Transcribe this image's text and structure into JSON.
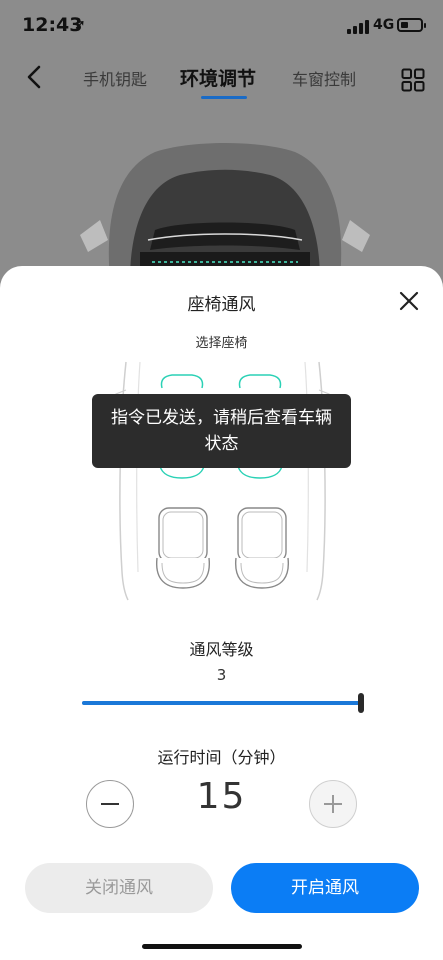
{
  "status_bar": {
    "time": "12:43",
    "location_glyph": "➚",
    "network": "4G"
  },
  "nav": {
    "tabs": [
      {
        "label": "手机钥匙"
      },
      {
        "label": "环境调节"
      },
      {
        "label": "车窗控制"
      }
    ],
    "active_tab": 1
  },
  "sheet": {
    "title": "座椅通风",
    "subtitle": "选择座椅",
    "toast": "指令已发送，请稍后查看车辆状态",
    "level_label": "通风等级",
    "level_value": "3",
    "level_fraction": 1.0,
    "time_label": "运行时间（分钟）",
    "duration": "15",
    "off_button": "关闭通风",
    "on_button": "开启通风"
  },
  "colors": {
    "accent": "#0b7df5",
    "slider_fill": "#1a78d8",
    "tab_underline": "#1a6bc6",
    "seat_selected": "#2ad1b5",
    "toast_bg": "#2c2c2c"
  }
}
